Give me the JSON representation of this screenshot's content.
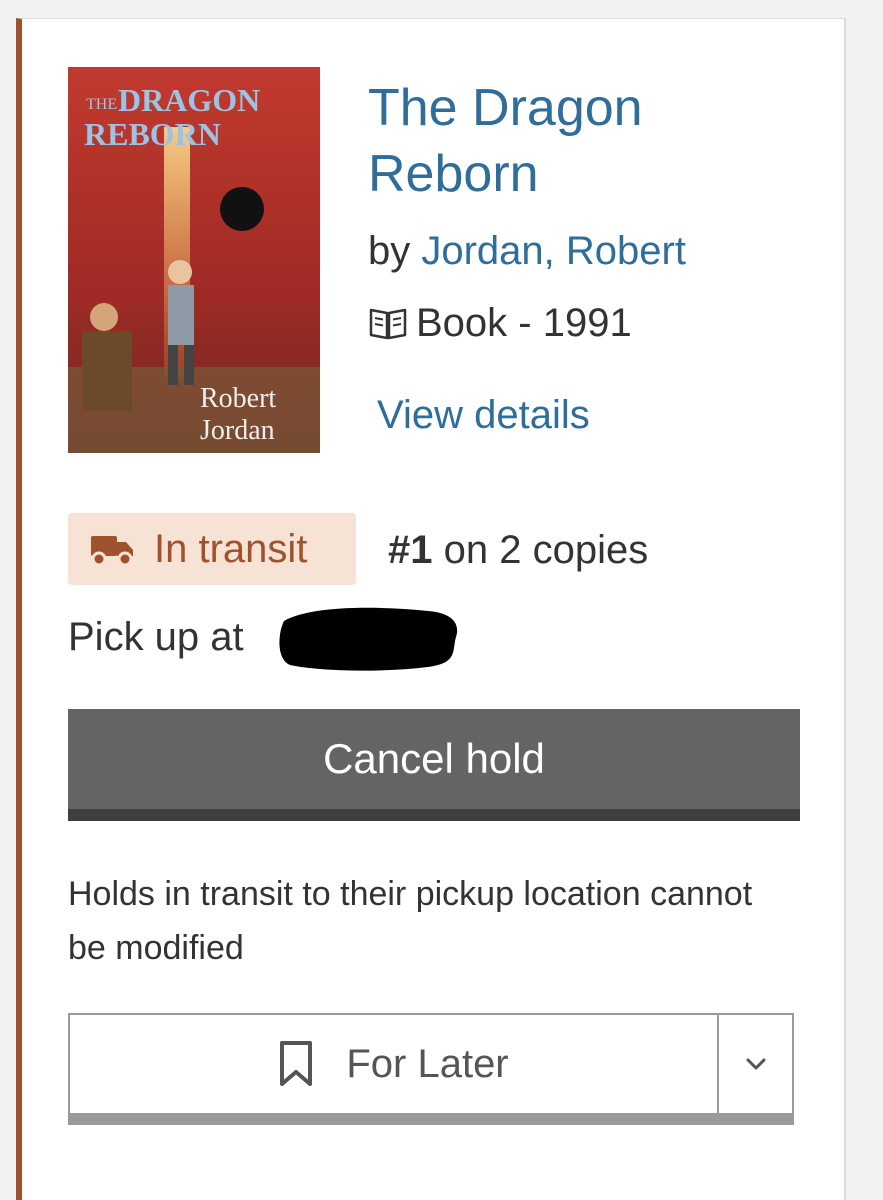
{
  "item": {
    "cover_alt": "The Dragon Reborn cover",
    "cover_text": {
      "title_line1": "DRAGON",
      "title_line2": "REBORN",
      "title_prefix": "THE",
      "author_line1": "Robert",
      "author_line2": "Jordan"
    },
    "title": "The Dragon Reborn",
    "by_prefix": "by ",
    "author": "Jordan, Robert",
    "format_icon": "book-icon",
    "format": "Book - 1991",
    "details_link": "View details"
  },
  "hold": {
    "status_icon": "truck-icon",
    "status": "In transit",
    "status_color": "#a0522d",
    "status_bg": "#f6e3d6",
    "queue_rank": "#1",
    "queue_text": " on 2 copies",
    "pickup_prefix": "Pick up at ",
    "cancel_label": "Cancel hold",
    "note": "Holds in transit to their pickup location cannot be modified"
  },
  "shelf": {
    "icon": "bookmark-icon",
    "label": "For Later",
    "toggle_icon": "chevron-down-icon"
  },
  "colors": {
    "link": "#2f6d9a",
    "accent_border": "#a0522d",
    "button_dark": "#646464"
  }
}
